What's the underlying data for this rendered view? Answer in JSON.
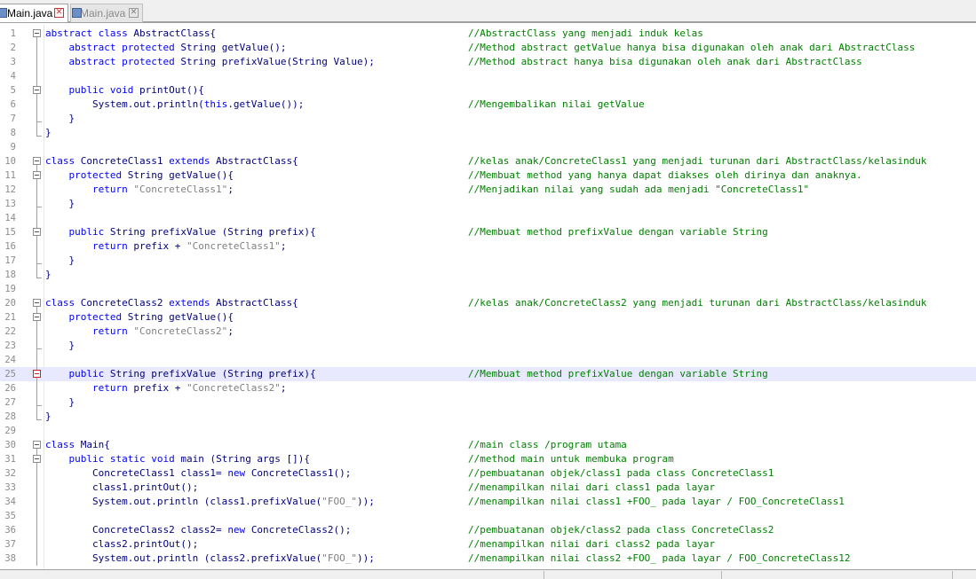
{
  "tabs": [
    {
      "label": "Main.java",
      "active": true
    },
    {
      "label": "Main.java",
      "active": false
    }
  ],
  "close_glyph": "✕",
  "colors": {
    "keyword": "#0000ff",
    "identifier": "#000080",
    "string": "#808080",
    "comment": "#008000",
    "line_number": "#8b8b8b",
    "current_line": "#e8e8ff"
  },
  "current_line": 25,
  "lines": [
    {
      "n": "1",
      "fold": "open",
      "segs": [
        [
          "k",
          "abstract class "
        ],
        [
          "p",
          "AbstractClass{"
        ]
      ],
      "comment": "//AbstractClass yang menjadi induk kelas"
    },
    {
      "n": "2",
      "fold": "line",
      "segs": [
        [
          "p",
          "    "
        ],
        [
          "k",
          "abstract protected "
        ],
        [
          "p",
          "String getValue();"
        ]
      ],
      "comment": "//Method abstract getValue hanya bisa digunakan oleh anak dari AbstractClass"
    },
    {
      "n": "3",
      "fold": "line",
      "segs": [
        [
          "p",
          "    "
        ],
        [
          "k",
          "abstract protected "
        ],
        [
          "p",
          "String prefixValue(String Value);"
        ]
      ],
      "comment": "//Method abstract hanya bisa digunakan oleh anak dari AbstractClass"
    },
    {
      "n": "4",
      "fold": "line",
      "segs": [],
      "comment": ""
    },
    {
      "n": "5",
      "fold": "open",
      "segs": [
        [
          "p",
          "    "
        ],
        [
          "k",
          "public void "
        ],
        [
          "p",
          "printOut(){"
        ]
      ],
      "comment": ""
    },
    {
      "n": "6",
      "fold": "line",
      "segs": [
        [
          "p",
          "        System.out.println("
        ],
        [
          "k",
          "this"
        ],
        [
          "p",
          ".getValue());"
        ]
      ],
      "comment": "//Mengembalikan nilai getValue"
    },
    {
      "n": "7",
      "fold": "end",
      "segs": [
        [
          "p",
          "    }"
        ]
      ],
      "comment": ""
    },
    {
      "n": "8",
      "fold": "end",
      "segs": [
        [
          "p",
          "}"
        ]
      ],
      "comment": ""
    },
    {
      "n": "9",
      "fold": "",
      "segs": [],
      "comment": ""
    },
    {
      "n": "10",
      "fold": "open",
      "segs": [
        [
          "k",
          "class "
        ],
        [
          "p",
          "ConcreteClass1 "
        ],
        [
          "k",
          "extends "
        ],
        [
          "p",
          "AbstractClass{"
        ]
      ],
      "comment": "//kelas anak/ConcreteClass1 yang menjadi turunan dari AbstractClass/kelasinduk"
    },
    {
      "n": "11",
      "fold": "open",
      "segs": [
        [
          "p",
          "    "
        ],
        [
          "k",
          "protected "
        ],
        [
          "p",
          "String getValue(){"
        ]
      ],
      "comment": "//Membuat method yang hanya dapat diakses oleh dirinya dan anaknya."
    },
    {
      "n": "12",
      "fold": "line",
      "segs": [
        [
          "p",
          "        "
        ],
        [
          "k",
          "return "
        ],
        [
          "s",
          "\"ConcreteClass1\""
        ],
        [
          "p",
          ";"
        ]
      ],
      "comment": "//Menjadikan nilai yang sudah ada menjadi \"ConcreteClass1\""
    },
    {
      "n": "13",
      "fold": "end",
      "segs": [
        [
          "p",
          "    }"
        ]
      ],
      "comment": ""
    },
    {
      "n": "14",
      "fold": "line",
      "segs": [],
      "comment": ""
    },
    {
      "n": "15",
      "fold": "open",
      "segs": [
        [
          "p",
          "    "
        ],
        [
          "k",
          "public "
        ],
        [
          "p",
          "String prefixValue (String prefix){"
        ]
      ],
      "comment": "//Membuat method prefixValue dengan variable String"
    },
    {
      "n": "16",
      "fold": "line",
      "segs": [
        [
          "p",
          "        "
        ],
        [
          "k",
          "return "
        ],
        [
          "p",
          "prefix + "
        ],
        [
          "s",
          "\"ConcreteClass1\""
        ],
        [
          "p",
          ";"
        ]
      ],
      "comment": ""
    },
    {
      "n": "17",
      "fold": "end",
      "segs": [
        [
          "p",
          "    }"
        ]
      ],
      "comment": ""
    },
    {
      "n": "18",
      "fold": "end",
      "segs": [
        [
          "p",
          "}"
        ]
      ],
      "comment": ""
    },
    {
      "n": "19",
      "fold": "",
      "segs": [],
      "comment": ""
    },
    {
      "n": "20",
      "fold": "open",
      "segs": [
        [
          "k",
          "class "
        ],
        [
          "p",
          "ConcreteClass2 "
        ],
        [
          "k",
          "extends "
        ],
        [
          "p",
          "AbstractClass{"
        ]
      ],
      "comment": "//kelas anak/ConcreteClass2 yang menjadi turunan dari AbstractClass/kelasinduk"
    },
    {
      "n": "21",
      "fold": "open",
      "segs": [
        [
          "p",
          "    "
        ],
        [
          "k",
          "protected "
        ],
        [
          "p",
          "String getValue(){"
        ]
      ],
      "comment": ""
    },
    {
      "n": "22",
      "fold": "line",
      "segs": [
        [
          "p",
          "        "
        ],
        [
          "k",
          "return "
        ],
        [
          "s",
          "\"ConcreteClass2\""
        ],
        [
          "p",
          ";"
        ]
      ],
      "comment": ""
    },
    {
      "n": "23",
      "fold": "end",
      "segs": [
        [
          "p",
          "    }"
        ]
      ],
      "comment": ""
    },
    {
      "n": "24",
      "fold": "line",
      "segs": [],
      "comment": ""
    },
    {
      "n": "25",
      "fold": "open-red",
      "segs": [
        [
          "p",
          "    "
        ],
        [
          "k",
          "public "
        ],
        [
          "p",
          "String prefixValue (String prefix){"
        ]
      ],
      "comment": "//Membuat method prefixValue dengan variable String"
    },
    {
      "n": "26",
      "fold": "line",
      "segs": [
        [
          "p",
          "        "
        ],
        [
          "k",
          "return "
        ],
        [
          "p",
          "prefix + "
        ],
        [
          "s",
          "\"ConcreteClass2\""
        ],
        [
          "p",
          ";"
        ]
      ],
      "comment": ""
    },
    {
      "n": "27",
      "fold": "end",
      "segs": [
        [
          "p",
          "    }"
        ]
      ],
      "comment": ""
    },
    {
      "n": "28",
      "fold": "end",
      "segs": [
        [
          "p",
          "}"
        ]
      ],
      "comment": ""
    },
    {
      "n": "29",
      "fold": "",
      "segs": [],
      "comment": ""
    },
    {
      "n": "30",
      "fold": "open",
      "segs": [
        [
          "k",
          "class "
        ],
        [
          "p",
          "Main{"
        ]
      ],
      "comment": "//main class /program utama"
    },
    {
      "n": "31",
      "fold": "open",
      "segs": [
        [
          "p",
          "    "
        ],
        [
          "k",
          "public static void "
        ],
        [
          "p",
          "main (String args []){"
        ]
      ],
      "comment": "//method main untuk membuka program"
    },
    {
      "n": "32",
      "fold": "line",
      "segs": [
        [
          "p",
          "        ConcreteClass1 class1= "
        ],
        [
          "k",
          "new "
        ],
        [
          "p",
          "ConcreteClass1();"
        ]
      ],
      "comment": "//pembuatanan objek/class1 pada class ConcreteClass1"
    },
    {
      "n": "33",
      "fold": "line",
      "segs": [
        [
          "p",
          "        class1.printOut();"
        ]
      ],
      "comment": "//menampilkan nilai dari class1 pada layar"
    },
    {
      "n": "34",
      "fold": "line",
      "segs": [
        [
          "p",
          "        System.out.println (class1.prefixValue("
        ],
        [
          "s",
          "\"FOO_\""
        ],
        [
          "p",
          "));"
        ]
      ],
      "comment": "//menampilkan nilai class1 +FOO_ pada layar / FOO_ConcreteClass1"
    },
    {
      "n": "35",
      "fold": "line",
      "segs": [],
      "comment": ""
    },
    {
      "n": "36",
      "fold": "line",
      "segs": [
        [
          "p",
          "        ConcreteClass2 class2= "
        ],
        [
          "k",
          "new "
        ],
        [
          "p",
          "ConcreteClass2();"
        ]
      ],
      "comment": "//pembuatanan objek/class2 pada class ConcreteClass2"
    },
    {
      "n": "37",
      "fold": "line",
      "segs": [
        [
          "p",
          "        class2.printOut();"
        ]
      ],
      "comment": "//menampilkan nilai dari class2 pada layar"
    },
    {
      "n": "38",
      "fold": "line",
      "segs": [
        [
          "p",
          "        System.out.println (class2.prefixValue("
        ],
        [
          "s",
          "\"FOO_\""
        ],
        [
          "p",
          "));"
        ]
      ],
      "comment": "//menampilkan nilai class2 +FOO_ pada layar / FOO_ConcreteClass12"
    }
  ]
}
